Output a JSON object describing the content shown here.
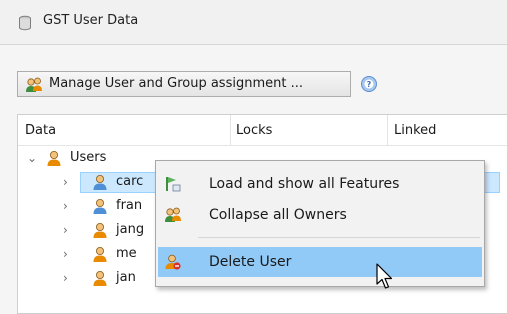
{
  "window": {
    "title": "GST User Data"
  },
  "toolbar": {
    "manage_label": "Manage User and Group assignment ..."
  },
  "table": {
    "columns": [
      "Data",
      "Locks",
      "Linked"
    ],
    "root": {
      "label": "Users",
      "expanded": true
    },
    "rows": [
      {
        "label": "carc",
        "selected": true
      },
      {
        "label": "fran"
      },
      {
        "label": "jang"
      },
      {
        "label": "me"
      },
      {
        "label": "jan"
      }
    ]
  },
  "context_menu": {
    "items": [
      {
        "label": "Load and show all Features",
        "icon": "load-features-icon"
      },
      {
        "label": "Collapse all Owners",
        "icon": "users-group-icon"
      },
      {
        "label": "Delete User",
        "icon": "delete-user-icon",
        "hovered": true
      }
    ]
  },
  "colors": {
    "selection": "#cce8ff",
    "menu_hover": "#91c9f7",
    "accent": "#e88b00"
  }
}
